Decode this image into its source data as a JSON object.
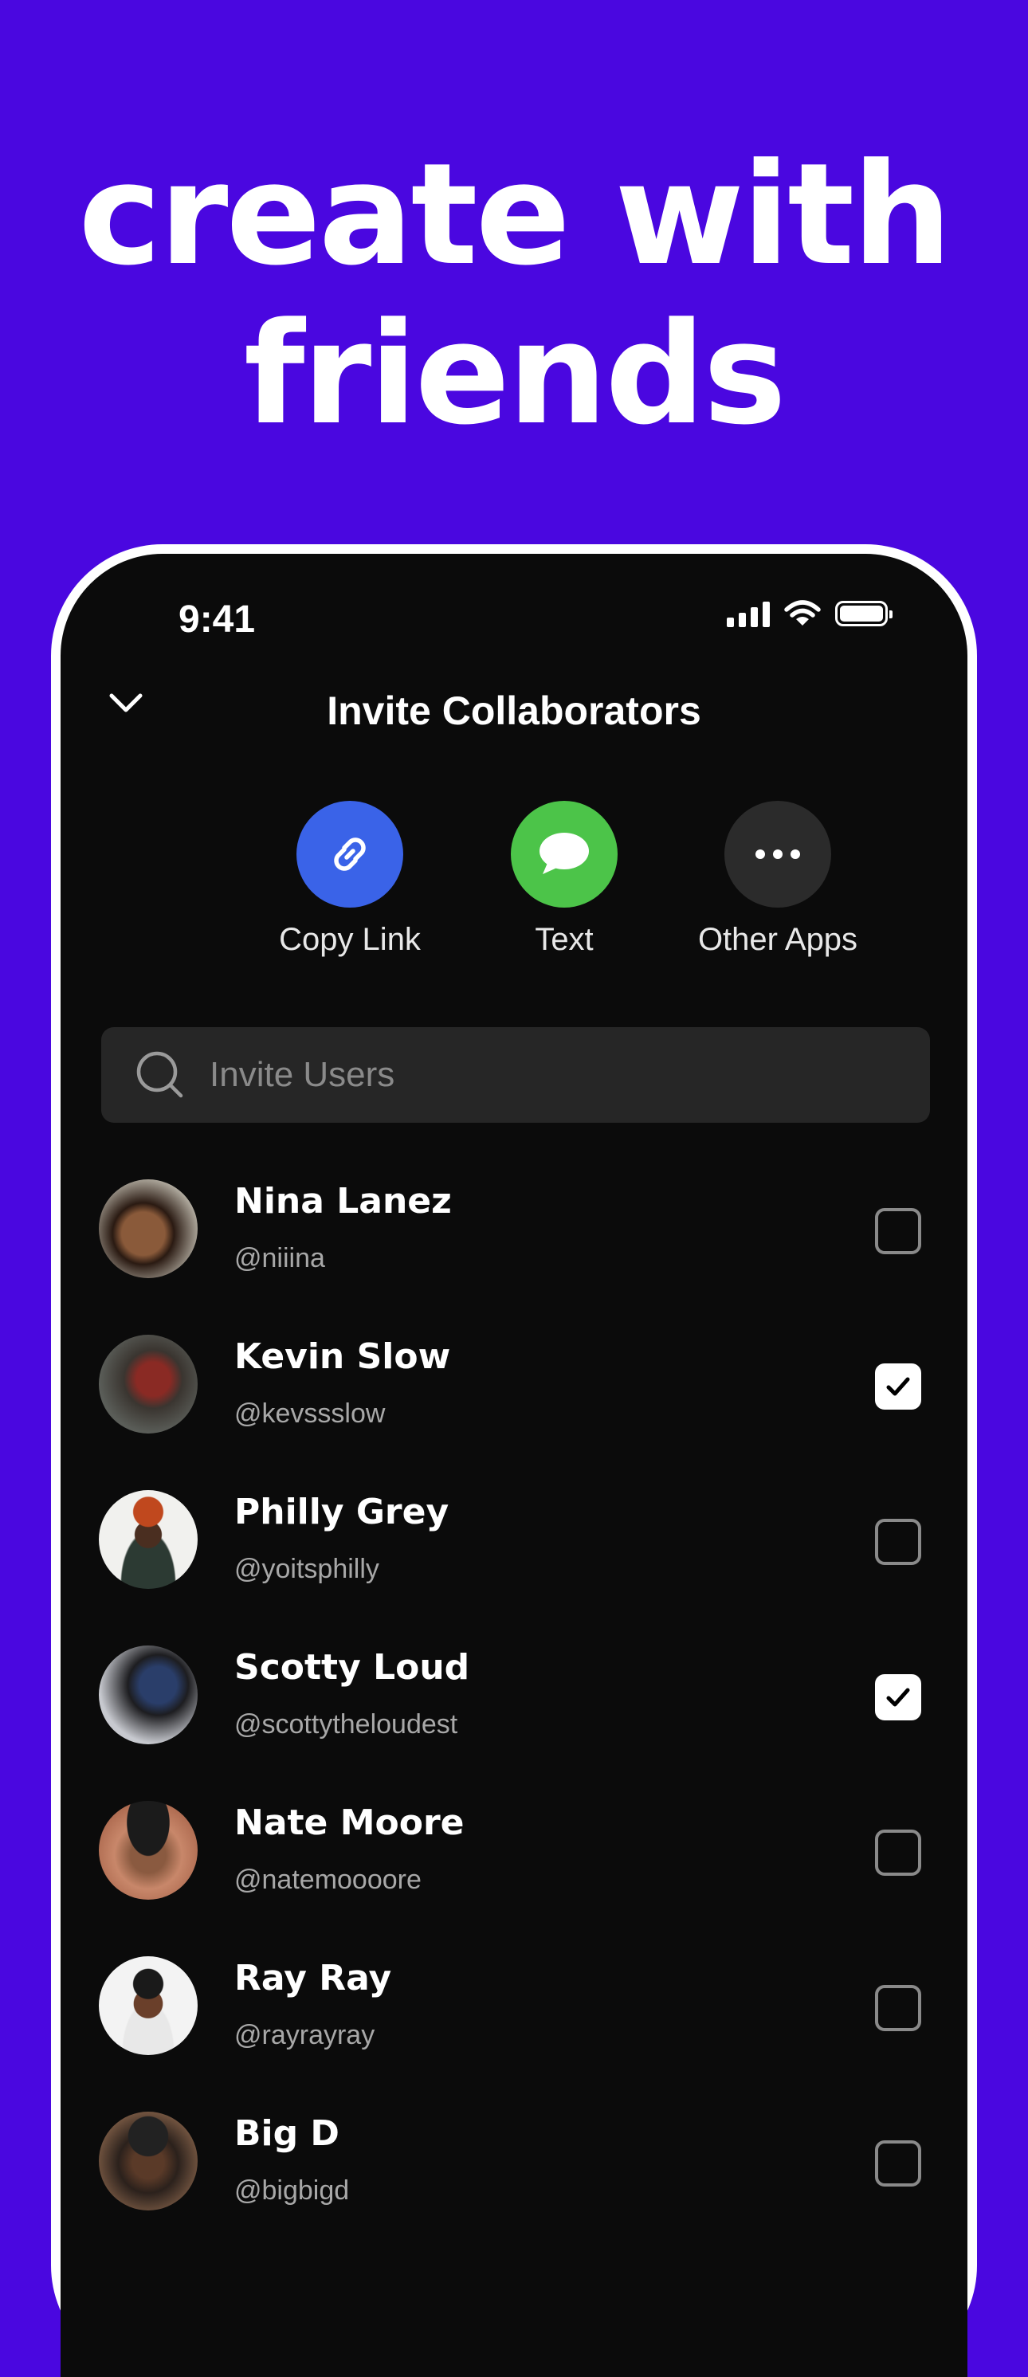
{
  "headline": {
    "line1": "create with",
    "line2": "friends"
  },
  "status_bar": {
    "time": "9:41"
  },
  "header": {
    "title": "Invite Collaborators"
  },
  "share_options": [
    {
      "label": "Copy Link",
      "icon": "link-icon",
      "color": "#3a63e8"
    },
    {
      "label": "Text",
      "icon": "message-icon",
      "color": "#4cc449"
    },
    {
      "label": "Other Apps",
      "icon": "more-icon",
      "color": "#2b2b2b"
    }
  ],
  "search": {
    "placeholder": "Invite Users"
  },
  "users": [
    {
      "name": "Nina Lanez",
      "handle": "@niiina",
      "checked": false
    },
    {
      "name": "Kevin Slow",
      "handle": "@kevssslow",
      "checked": true
    },
    {
      "name": "Philly Grey",
      "handle": "@yoitsphilly",
      "checked": false
    },
    {
      "name": "Scotty Loud",
      "handle": "@scottytheloudest",
      "checked": true
    },
    {
      "name": "Nate Moore",
      "handle": "@natemoooore",
      "checked": false
    },
    {
      "name": "Ray Ray",
      "handle": "@rayrayray",
      "checked": false
    },
    {
      "name": "Big D",
      "handle": "@bigbigd",
      "checked": false
    }
  ],
  "colors": {
    "background": "#4a07e0",
    "screen": "#0b0b0b",
    "accent_link": "#3a63e8",
    "accent_text": "#4cc449"
  }
}
